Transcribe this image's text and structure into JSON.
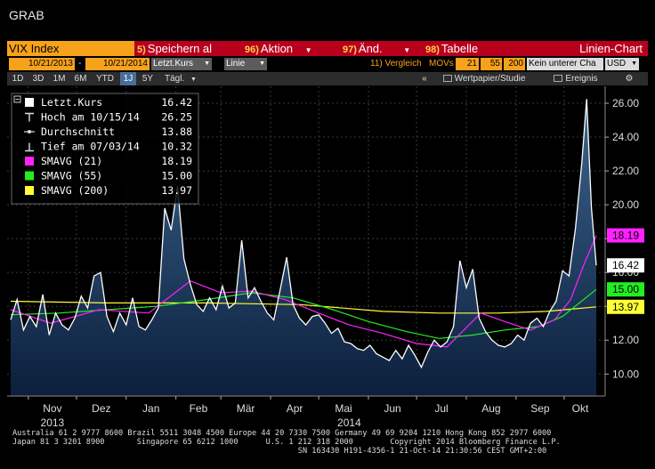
{
  "window": {
    "title": "GRAB"
  },
  "command_bar": {
    "security": "VIX Index",
    "items": [
      {
        "num": "5)",
        "label": "Speichern al"
      },
      {
        "num": "96)",
        "label": "Aktion"
      },
      {
        "num": "97)",
        "label": "Änd."
      },
      {
        "num": "98)",
        "label": "Tabelle"
      }
    ],
    "chart_kind": "Linien-Chart"
  },
  "params": {
    "start_date": "10/21/2013",
    "dash": "-",
    "end_date": "10/21/2014",
    "field": "Letzt.Kurs",
    "style": "Linie",
    "compare": "11) Vergleich",
    "movs": "MOVs",
    "mov1": "21",
    "mov2": "55",
    "mov3": "200",
    "lower": "Kein unterer Cha",
    "currency": "USD"
  },
  "tabs": {
    "periods": [
      "1D",
      "3D",
      "1M",
      "6M",
      "YTD",
      "1J",
      "5Y"
    ],
    "active_period": "1J",
    "freq": "Tägl.",
    "security_study": "Wertpapier/Studie",
    "events": "Ereignis",
    "collapse_icon": "double-chevron-left",
    "gear_icon": "gear"
  },
  "legend": {
    "rows": [
      {
        "label": "Letzt.Kurs",
        "value": "16.42",
        "swatch": "#ffffff"
      },
      {
        "label": "Hoch am 10/15/14",
        "value": "26.25",
        "swatch": "high-marker"
      },
      {
        "label": "Durchschnitt",
        "value": "13.88",
        "swatch": "avg-marker"
      },
      {
        "label": "Tief am 07/03/14",
        "value": "10.32",
        "swatch": "low-marker"
      },
      {
        "label": "SMAVG (21)",
        "value": "18.19",
        "swatch": "#ff22ff"
      },
      {
        "label": "SMAVG (55)",
        "value": "15.00",
        "swatch": "#22ee22"
      },
      {
        "label": "SMAVG (200)",
        "value": "13.97",
        "swatch": "#ffff33"
      }
    ]
  },
  "chart_data": {
    "type": "area",
    "title": "",
    "ylim": [
      8.7,
      27.0
    ],
    "yticks": [
      "10.00",
      "12.00",
      "14.00",
      "16.00",
      "18.00",
      "20.00",
      "22.00",
      "24.00",
      "26.00"
    ],
    "ytick_values": [
      10,
      12,
      14,
      16,
      18,
      20,
      22,
      24,
      26
    ],
    "xtick_labels": [
      "Nov",
      "Dez",
      "Jan",
      "Feb",
      "Mär",
      "Apr",
      "Mai",
      "Jun",
      "Jul",
      "Aug",
      "Sep",
      "Okt"
    ],
    "xtick_dates": [
      "2013-11-01",
      "2013-12-01",
      "2014-01-01",
      "2014-02-01",
      "2014-03-01",
      "2014-04-01",
      "2014-05-01",
      "2014-06-01",
      "2014-07-01",
      "2014-08-01",
      "2014-09-01",
      "2014-10-01"
    ],
    "year_labels": [
      {
        "label": "2013",
        "date": "2013-11-16"
      },
      {
        "label": "2014",
        "date": "2014-05-20"
      }
    ],
    "start_date": "2013-10-21",
    "end_date": "2014-10-21",
    "series": [
      {
        "name": "Letzt.Kurs",
        "color": "#ffffff",
        "dates": [
          "2013-10-21",
          "2013-10-25",
          "2013-10-29",
          "2013-11-02",
          "2013-11-06",
          "2013-11-10",
          "2013-11-14",
          "2013-11-18",
          "2013-11-22",
          "2013-11-26",
          "2013-11-30",
          "2013-12-04",
          "2013-12-08",
          "2013-12-12",
          "2013-12-16",
          "2013-12-20",
          "2013-12-24",
          "2013-12-28",
          "2014-01-01",
          "2014-01-05",
          "2014-01-09",
          "2014-01-13",
          "2014-01-17",
          "2014-01-21",
          "2014-01-25",
          "2014-01-29",
          "2014-02-02",
          "2014-02-06",
          "2014-02-10",
          "2014-02-14",
          "2014-02-18",
          "2014-02-22",
          "2014-02-26",
          "2014-03-02",
          "2014-03-06",
          "2014-03-10",
          "2014-03-14",
          "2014-03-18",
          "2014-03-22",
          "2014-03-26",
          "2014-03-30",
          "2014-04-03",
          "2014-04-07",
          "2014-04-11",
          "2014-04-15",
          "2014-04-19",
          "2014-04-23",
          "2014-04-27",
          "2014-05-01",
          "2014-05-05",
          "2014-05-09",
          "2014-05-13",
          "2014-05-17",
          "2014-05-21",
          "2014-05-25",
          "2014-05-29",
          "2014-06-02",
          "2014-06-06",
          "2014-06-10",
          "2014-06-14",
          "2014-06-18",
          "2014-06-22",
          "2014-06-26",
          "2014-06-30",
          "2014-07-04",
          "2014-07-08",
          "2014-07-12",
          "2014-07-16",
          "2014-07-20",
          "2014-07-24",
          "2014-07-28",
          "2014-08-01",
          "2014-08-05",
          "2014-08-09",
          "2014-08-13",
          "2014-08-17",
          "2014-08-21",
          "2014-08-25",
          "2014-08-29",
          "2014-09-02",
          "2014-09-06",
          "2014-09-10",
          "2014-09-14",
          "2014-09-18",
          "2014-09-22",
          "2014-09-26",
          "2014-09-30",
          "2014-10-04",
          "2014-10-08",
          "2014-10-12",
          "2014-10-15",
          "2014-10-18",
          "2014-10-21"
        ],
        "values": [
          13.2,
          14.4,
          12.6,
          13.4,
          12.8,
          14.7,
          12.3,
          13.6,
          12.9,
          12.6,
          13.3,
          14.6,
          13.9,
          15.8,
          16.0,
          13.4,
          12.5,
          13.6,
          12.9,
          14.5,
          12.8,
          12.6,
          13.2,
          13.9,
          19.8,
          18.5,
          21.1,
          16.8,
          15.3,
          14.1,
          13.7,
          14.5,
          13.8,
          15.2,
          13.9,
          14.2,
          17.9,
          14.5,
          15.1,
          14.3,
          13.6,
          13.2,
          15.0,
          16.9,
          14.1,
          13.3,
          12.9,
          13.4,
          13.5,
          13.0,
          12.4,
          12.7,
          11.9,
          11.8,
          11.5,
          11.4,
          11.7,
          11.2,
          11.0,
          10.8,
          11.4,
          10.9,
          11.7,
          11.1,
          10.4,
          11.3,
          12.0,
          11.6,
          11.9,
          12.8,
          16.7,
          15.1,
          16.2,
          13.3,
          12.5,
          12.0,
          11.7,
          11.6,
          11.8,
          12.3,
          12.0,
          13.0,
          13.3,
          12.8,
          13.7,
          14.3,
          16.1,
          15.8,
          18.6,
          22.5,
          26.25,
          19.8,
          16.42
        ]
      },
      {
        "name": "SMAVG (21)",
        "color": "#ff22ff",
        "dates": [
          "2013-10-21",
          "2013-11-15",
          "2013-12-15",
          "2014-01-15",
          "2014-02-10",
          "2014-03-01",
          "2014-03-20",
          "2014-04-10",
          "2014-05-01",
          "2014-05-20",
          "2014-06-10",
          "2014-07-01",
          "2014-07-20",
          "2014-08-10",
          "2014-08-25",
          "2014-09-10",
          "2014-09-25",
          "2014-10-05",
          "2014-10-13",
          "2014-10-21"
        ],
        "values": [
          13.8,
          13.0,
          13.8,
          13.6,
          15.5,
          14.8,
          14.9,
          14.4,
          13.6,
          12.9,
          12.4,
          11.8,
          11.6,
          13.6,
          13.1,
          12.6,
          13.2,
          14.4,
          16.4,
          18.19
        ]
      },
      {
        "name": "SMAVG (55)",
        "color": "#22ee22",
        "dates": [
          "2013-10-21",
          "2013-11-20",
          "2013-12-20",
          "2014-01-20",
          "2014-02-20",
          "2014-03-20",
          "2014-04-15",
          "2014-05-10",
          "2014-06-01",
          "2014-06-25",
          "2014-07-15",
          "2014-08-05",
          "2014-08-25",
          "2014-09-15",
          "2014-09-30",
          "2014-10-21"
        ],
        "values": [
          13.5,
          13.6,
          13.8,
          14.0,
          14.4,
          14.8,
          14.5,
          13.8,
          13.1,
          12.5,
          12.1,
          12.3,
          12.6,
          12.8,
          13.4,
          15.0
        ]
      },
      {
        "name": "SMAVG (200)",
        "color": "#ffff33",
        "dates": [
          "2013-10-21",
          "2013-12-20",
          "2014-02-20",
          "2014-04-20",
          "2014-06-10",
          "2014-07-15",
          "2014-08-20",
          "2014-09-20",
          "2014-10-21"
        ],
        "values": [
          14.3,
          14.2,
          14.2,
          14.1,
          13.7,
          13.6,
          13.6,
          13.7,
          13.97
        ]
      }
    ],
    "last_value_labels": [
      {
        "value": "18.19",
        "bg": "#ff22ff",
        "fg": "#000000"
      },
      {
        "value": "16.42",
        "bg": "#ffffff",
        "fg": "#000000"
      },
      {
        "value": "15.00",
        "bg": "#22ee22",
        "fg": "#000000"
      },
      {
        "value": "13.97",
        "bg": "#ffff33",
        "fg": "#000000"
      }
    ]
  },
  "footer": {
    "line1": "Australia 61 2 9777 8600 Brazil 5511 3048 4500 Europe 44 20 7330 7500 Germany 49 69 9204 1210 Hong Kong 852 2977 6000",
    "line2": "Japan 81 3 3201 8900       Singapore 65 6212 1000      U.S. 1 212 318 2000        Copyright 2014 Bloomberg Finance L.P.",
    "line3": "                                                              SN 163430 H191-4356-1 21-Oct-14 21:30:56 CEST GMT+2:00"
  }
}
